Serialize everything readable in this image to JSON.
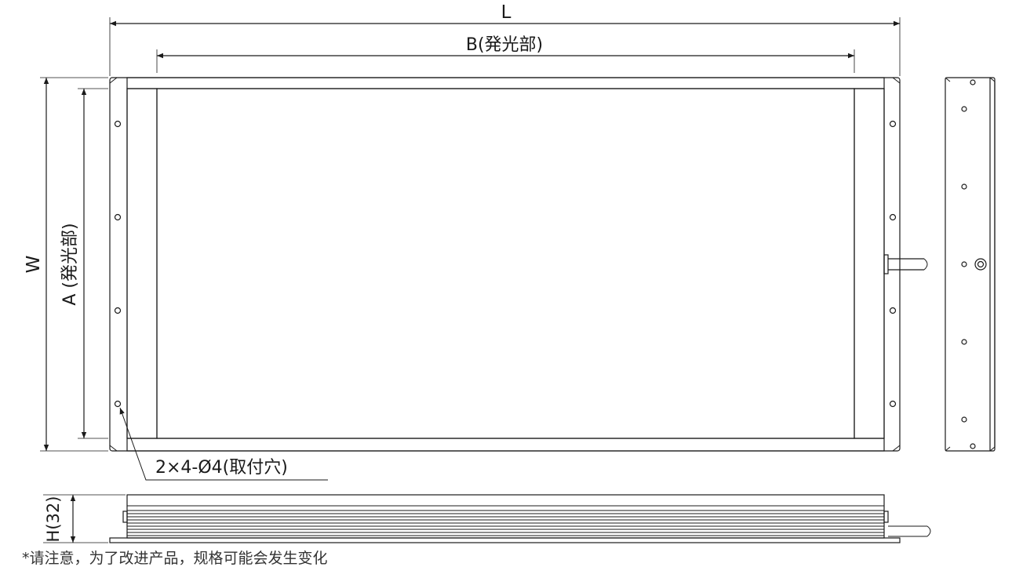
{
  "dimensions": {
    "length": "L",
    "emitting_length": "B(発光部)",
    "width": "W",
    "emitting_width": "A (発光部)",
    "height": "H(32)",
    "mounting_holes": "2×4-Ø4(取付穴)"
  },
  "note": "*请注意，为了改进产品，规格可能会发生变化",
  "colors": {
    "line": "#1a1a1a",
    "panel": "#ffffff"
  }
}
